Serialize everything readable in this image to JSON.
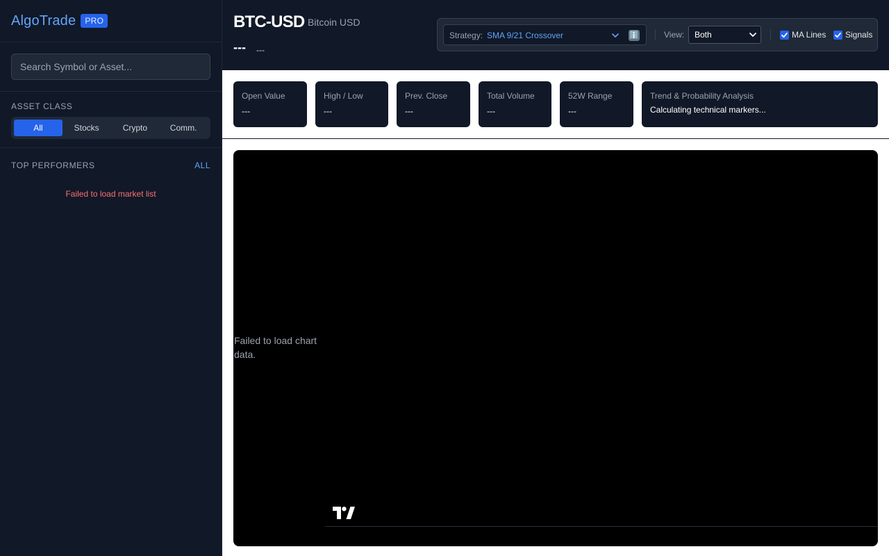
{
  "sidebar": {
    "brand": "AlgoTrade",
    "badge": "PRO",
    "search_placeholder": "Search Symbol or Asset...",
    "asset_class_title": "ASSET CLASS",
    "asset_classes": [
      "All",
      "Stocks",
      "Crypto",
      "Comm."
    ],
    "active_asset_class": "All",
    "top_performers_title": "TOP PERFORMERS",
    "top_performers_link": "ALL",
    "market_list_error": "Failed to load market list"
  },
  "header": {
    "symbol": "BTC-USD",
    "symbol_name": "Bitcoin USD",
    "price": "---",
    "change": "---",
    "strategy_label": "Strategy:",
    "strategy_value": "SMA 9/21 Crossover",
    "info_icon": "ℹ️",
    "view_label": "View:",
    "view_value": "Both",
    "ma_lines_label": "MA Lines",
    "ma_lines_checked": true,
    "signals_label": "Signals",
    "signals_checked": true
  },
  "stats": [
    {
      "label": "Open Value",
      "value": "---"
    },
    {
      "label": "High / Low",
      "value": "---"
    },
    {
      "label": "Prev. Close",
      "value": "---"
    },
    {
      "label": "Total Volume",
      "value": "---"
    },
    {
      "label": "52W Range",
      "value": "---"
    }
  ],
  "trend": {
    "label": "Trend & Probability Analysis",
    "value": "Calculating technical markers..."
  },
  "chart": {
    "error_message": "Failed to load chart data.",
    "logo_icon": "tradingview-logo-icon"
  },
  "colors": {
    "sidebar_bg": "#111827",
    "accent": "#2563eb",
    "link": "#60a5fa",
    "error": "#f87171",
    "chart_bg": "#000000"
  }
}
